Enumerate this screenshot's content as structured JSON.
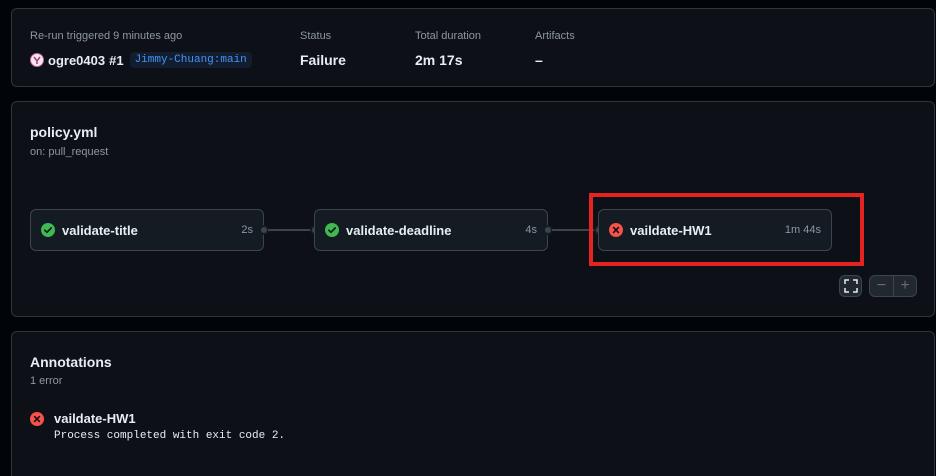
{
  "summary": {
    "trigger_label": "Re-run triggered 9 minutes ago",
    "actor": "ogre0403",
    "run_number": "#1",
    "branch": "Jimmy-Chuang:main",
    "status_label": "Status",
    "status_value": "Failure",
    "duration_label": "Total duration",
    "duration_value": "2m 17s",
    "artifacts_label": "Artifacts",
    "artifacts_value": "–"
  },
  "workflow": {
    "name": "policy.yml",
    "trigger": "on: pull_request",
    "jobs": [
      {
        "name": "validate-title",
        "duration": "2s",
        "status": "success"
      },
      {
        "name": "validate-deadline",
        "duration": "4s",
        "status": "success"
      },
      {
        "name": "vaildate-HW1",
        "duration": "1m 44s",
        "status": "failure"
      }
    ]
  },
  "annotations": {
    "title": "Annotations",
    "count_label": "1 error",
    "items": [
      {
        "job": "vaildate-HW1",
        "message": "Process completed with exit code 2.",
        "icon": "x-circle-icon"
      }
    ]
  },
  "colors": {
    "success": "#3fb950",
    "failure": "#f85149",
    "highlight": "#e52421",
    "link": "#4493f8"
  },
  "icons": {
    "fullscreen": "fullscreen-icon",
    "zoom_out": "−",
    "zoom_in": "+"
  }
}
